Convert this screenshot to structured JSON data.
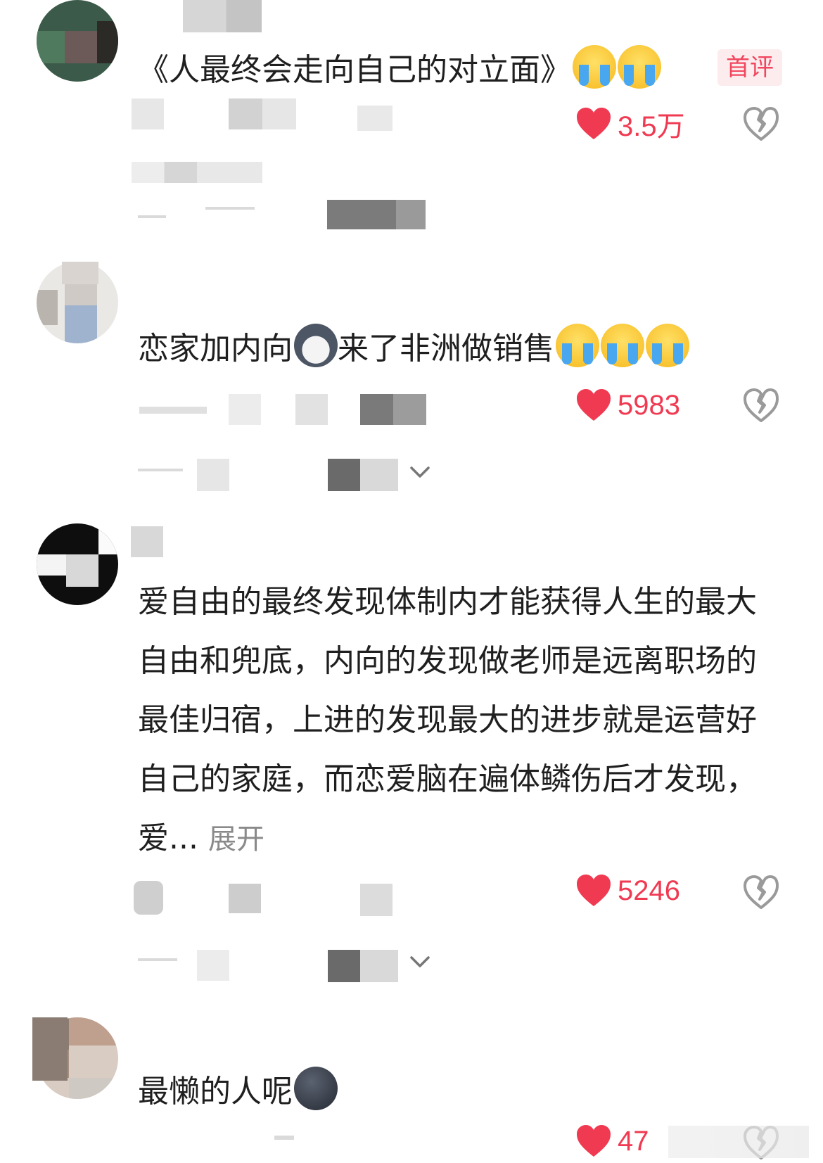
{
  "comments": [
    {
      "text": "《人最终会走向自己的对立面》",
      "emoji": [
        "crying-face-emoji",
        "crying-face-emoji"
      ],
      "badge": "首评",
      "likes": "3.5万"
    },
    {
      "text": "恋家加内向",
      "text2": "来了非洲做销售",
      "emoji_mid": "husky-emoji",
      "emoji": [
        "tearful-face-emoji",
        "tearful-face-emoji",
        "tearful-face-emoji"
      ],
      "likes": "5983"
    },
    {
      "text": "爱自由的最终发现体制内才能获得人生的最大自由和兜底，内向的发现做老师是远离职场的最佳归宿，上进的发现最大的进步就是运营好自己的家庭，而恋爱脑在遍体鳞伤后才发现，爱...",
      "expand": "展开",
      "likes": "5246"
    },
    {
      "text": "最懒的人呢",
      "emoji": [
        "seal-emoji"
      ],
      "likes": "47"
    }
  ],
  "colors": {
    "like_red": "#f03a52",
    "badge_bg": "#fdecee",
    "badge_text": "#f0475f",
    "text": "#1f1f1f",
    "muted": "#8a8a8a"
  }
}
